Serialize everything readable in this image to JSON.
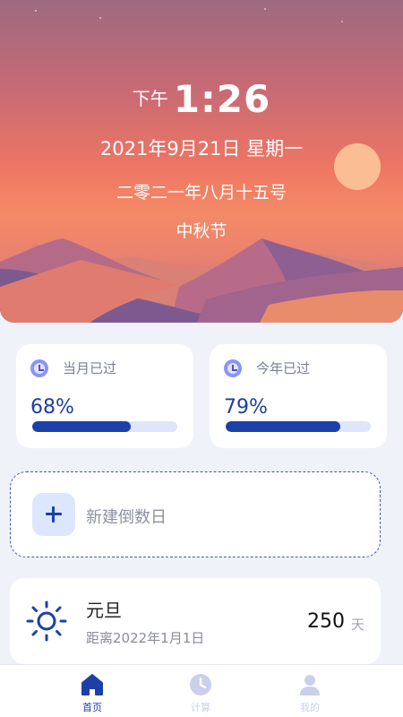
{
  "hero": {
    "time_prefix": "下午",
    "time": "1:26",
    "date": "2021年9月21日  星期一",
    "lunar_date": "二零二一年八月十五号",
    "festival": "中秋节"
  },
  "progress_cards": [
    {
      "label": "当月已过",
      "percent_text": "68%",
      "progress": 0.68,
      "icon": "clock-icon"
    },
    {
      "label": "今年已过",
      "percent_text": "79%",
      "progress": 0.79,
      "icon": "clock-icon"
    }
  ],
  "new_countdown": {
    "label": "新建倒数日",
    "icon": "plus-icon"
  },
  "holiday": {
    "name": "元旦",
    "subtitle": "距离2022年1月1日",
    "days": "250",
    "unit": "天",
    "icon": "sun-icon"
  },
  "tabbar": {
    "items": [
      {
        "label": "首页",
        "icon": "home-icon",
        "active": true
      },
      {
        "label": "计算",
        "icon": "clock-icon",
        "active": false
      },
      {
        "label": "我的",
        "icon": "user-icon",
        "active": false
      }
    ]
  },
  "colors": {
    "accent": "#1d40a8",
    "progress_track": "#dfe6fb",
    "page_background": "#f0f2fa"
  }
}
